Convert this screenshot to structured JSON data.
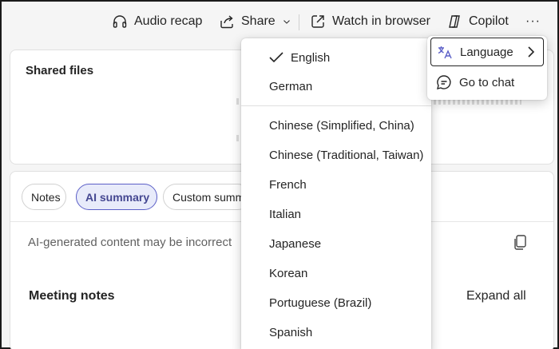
{
  "toolbar": {
    "audio_recap": "Audio recap",
    "share": "Share",
    "watch_in_browser": "Watch in browser",
    "copilot": "Copilot",
    "more": "···"
  },
  "shared_files": {
    "title": "Shared files"
  },
  "summary": {
    "tabs": [
      {
        "label": "Notes",
        "active": false
      },
      {
        "label": "AI summary",
        "active": true
      },
      {
        "label": "Custom summ",
        "active": false
      }
    ],
    "disclaimer": "AI-generated content may be incorrect",
    "meeting_notes_title": "Meeting notes",
    "expand_all": "Expand all"
  },
  "language_menu": {
    "selected": "English",
    "items": [
      "English",
      "German",
      "Chinese (Simplified, China)",
      "Chinese (Traditional, Taiwan)",
      "French",
      "Italian",
      "Japanese",
      "Korean",
      "Portuguese (Brazil)",
      "Spanish"
    ]
  },
  "more_menu": {
    "items": [
      {
        "label": "Language",
        "icon": "translate-icon",
        "has_submenu": true
      },
      {
        "label": "Go to chat",
        "icon": "chat-icon",
        "has_submenu": false
      }
    ]
  },
  "colors": {
    "accent": "#5b5fc7",
    "accent_bg": "#e8ebfa",
    "accent_text": "#444791"
  }
}
